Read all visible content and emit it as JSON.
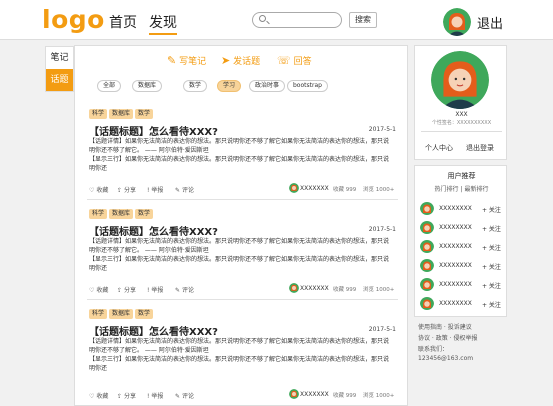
{
  "header": {
    "logo": "logo",
    "nav": [
      "首页",
      "发现"
    ],
    "search_placeholder": "",
    "search_button": "搜索",
    "logout": "退出"
  },
  "left_tabs": [
    "笔记",
    "话题"
  ],
  "actions": {
    "write_note": "写笔记",
    "post_topic": "发话题",
    "answer": "回答"
  },
  "categories": [
    "全部",
    "数据库",
    "数学",
    "学习",
    "政治时事",
    "bootstrap"
  ],
  "active_category": "学习",
  "posts": [
    {
      "tags": [
        "科学",
        "数据库",
        "数学"
      ],
      "title": "【话题标题】怎么看待XXX?",
      "date": "2017-5-1",
      "line1": "【话题详情】如果你无法简洁的表达你的想法。那只说明你还不够了解它如果你无法简洁的表达你的想法，那只说",
      "line2": "明你还不够了解它。 —— 阿尔伯特·爱因斯坦",
      "line3": "【显示三行】如果你无法简洁的表达你的想法。那只说明你还不够了解它如果你无法简洁的表达你的想法，那只说",
      "line4": "明你还",
      "footer": {
        "collect": "收藏",
        "share": "分享",
        "report": "举报",
        "comment": "评论",
        "user": "XXXXXXX",
        "collect_label": "收藏",
        "collect_count": "999",
        "view_label": "浏览",
        "view_count": "1000+"
      }
    },
    {
      "tags": [
        "科学",
        "数据库",
        "数学"
      ],
      "title": "【话题标题】怎么看待XXX?",
      "date": "2017-5-1",
      "line1": "【话题详情】如果你无法简洁的表达你的想法。那只说明你还不够了解它如果你无法简洁的表达你的想法，那只说",
      "line2": "明你还不够了解它。 —— 阿尔伯特·爱因斯坦",
      "line3": "【显示三行】如果你无法简洁的表达你的想法。那只说明你还不够了解它如果你无法简洁的表达你的想法，那只说",
      "line4": "明你还",
      "footer": {
        "collect": "收藏",
        "share": "分享",
        "report": "举报",
        "comment": "评论",
        "user": "XXXXXXX",
        "collect_label": "收藏",
        "collect_count": "999",
        "view_label": "浏览",
        "view_count": "1000+"
      }
    },
    {
      "tags": [
        "科学",
        "数据库",
        "数学"
      ],
      "title": "【话题标题】怎么看待XXX?",
      "date": "2017-5-1",
      "line1": "【话题详情】如果你无法简洁的表达你的想法。那只说明你还不够了解它如果你无法简洁的表达你的想法，那只说",
      "line2": "明你还不够了解它。 —— 阿尔伯特·爱因斯坦",
      "line3": "【显示三行】如果你无法简洁的表达你的想法。那只说明你还不够了解它如果你无法简洁的表达你的想法，那只说",
      "line4": "明你还",
      "footer": {
        "collect": "收藏",
        "share": "分享",
        "report": "举报",
        "comment": "评论",
        "user": "XXXXXXX",
        "collect_label": "收藏",
        "collect_count": "999",
        "view_label": "浏览",
        "view_count": "1000+"
      }
    }
  ],
  "profile": {
    "name": "XXX",
    "bio": "个性签名：XXXXXXXXXX",
    "personal_center": "个人中心",
    "logout": "退出登录"
  },
  "recommend": {
    "title": "用户推荐",
    "sort_hot": "热门排行",
    "sort_sep": "|",
    "sort_new": "最新排行",
    "users": [
      {
        "name": "XXXXXXXX",
        "follow": "+ 关注"
      },
      {
        "name": "XXXXXXXX",
        "follow": "+ 关注"
      },
      {
        "name": "XXXXXXXX",
        "follow": "+ 关注"
      },
      {
        "name": "XXXXXXXX",
        "follow": "+ 关注"
      },
      {
        "name": "XXXXXXXX",
        "follow": "+ 关注"
      },
      {
        "name": "XXXXXXXX",
        "follow": "+ 关注"
      }
    ]
  },
  "footer": {
    "line1": "使用指南 · 投诉建议",
    "line2": "协议 · 政策 · 侵权举报",
    "line3": "联系我们：",
    "line4": "123456@163.com"
  },
  "colors": {
    "accent": "#f39c12",
    "tag_bg": "#f8d49a"
  }
}
